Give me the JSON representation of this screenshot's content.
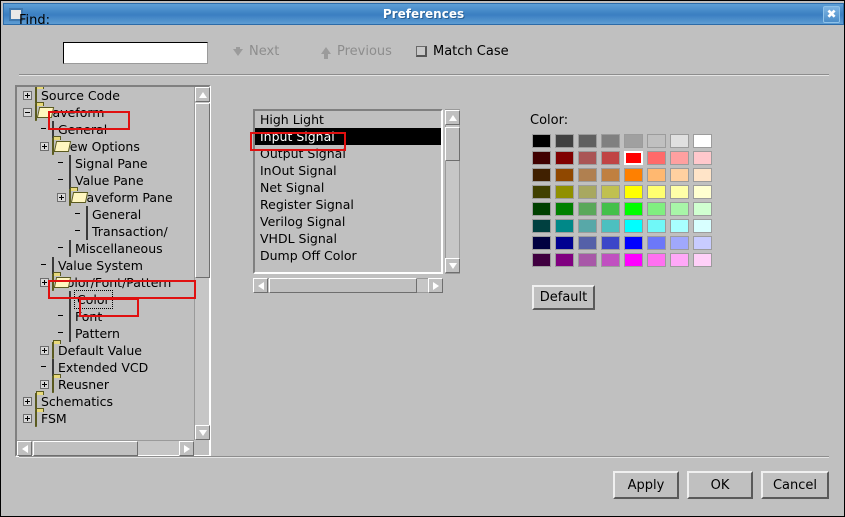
{
  "window": {
    "title": "Preferences",
    "icon": "window-menu-icon",
    "close_label": "✖"
  },
  "toolbar": {
    "find_label": "Find:",
    "find_value": "",
    "find_placeholder": "",
    "next_label": "Next",
    "previous_label": "Previous",
    "match_case_label": "Match Case",
    "match_case_checked": false
  },
  "tree": {
    "items": [
      {
        "label": "Source Code",
        "indent": 0,
        "expander": "plus",
        "icon": "folder-icon"
      },
      {
        "label": "Waveform",
        "indent": 0,
        "expander": "minus",
        "icon": "folder-open-icon",
        "highlight": true
      },
      {
        "label": "General",
        "indent": 1,
        "expander": "none",
        "icon": "document-icon"
      },
      {
        "label": "View Options",
        "indent": 1,
        "expander": "plus",
        "icon": "folder-open-icon"
      },
      {
        "label": "Signal Pane",
        "indent": 2,
        "expander": "none",
        "icon": "document-icon"
      },
      {
        "label": "Value Pane",
        "indent": 2,
        "expander": "none",
        "icon": "document-icon"
      },
      {
        "label": "Waveform Pane",
        "indent": 2,
        "expander": "plus",
        "icon": "folder-open-icon"
      },
      {
        "label": "General",
        "indent": 3,
        "expander": "none",
        "icon": "document-icon"
      },
      {
        "label": "Transaction/",
        "indent": 3,
        "expander": "none",
        "icon": "document-icon"
      },
      {
        "label": "Miscellaneous",
        "indent": 2,
        "expander": "none",
        "icon": "document-icon"
      },
      {
        "label": "Value System",
        "indent": 1,
        "expander": "none",
        "icon": "document-icon"
      },
      {
        "label": "Color/Font/Pattern",
        "indent": 1,
        "expander": "plus",
        "icon": "folder-open-icon",
        "highlight": true
      },
      {
        "label": "Color",
        "indent": 2,
        "expander": "none",
        "icon": "document-icon",
        "selected": true,
        "highlight": true
      },
      {
        "label": "Font",
        "indent": 2,
        "expander": "none",
        "icon": "document-icon"
      },
      {
        "label": "Pattern",
        "indent": 2,
        "expander": "none",
        "icon": "document-icon"
      },
      {
        "label": "Default Value",
        "indent": 1,
        "expander": "plus",
        "icon": "folder-icon"
      },
      {
        "label": "Extended VCD",
        "indent": 1,
        "expander": "none",
        "icon": "document-icon"
      },
      {
        "label": "Reusner",
        "indent": 1,
        "expander": "plus",
        "icon": "folder-icon"
      },
      {
        "label": "Schematics",
        "indent": 0,
        "expander": "plus",
        "icon": "folder-icon"
      },
      {
        "label": "FSM",
        "indent": 0,
        "expander": "plus",
        "icon": "folder-icon"
      }
    ]
  },
  "signal_list": {
    "items": [
      "High Light",
      "Input Signal",
      "Output Signal",
      "InOut Signal",
      "Net Signal",
      "Register Signal",
      "Verilog Signal",
      "VHDL Signal",
      "Dump Off Color"
    ],
    "selected_index": 1
  },
  "color_section": {
    "label": "Color:",
    "default_button": "Default",
    "selected_index": 12,
    "swatches": [
      "#000000",
      "#404040",
      "#606060",
      "#808080",
      "#a0a0a0",
      "#c0c0c0",
      "#e0e0e0",
      "#ffffff",
      "#400000",
      "#800000",
      "#aa5555",
      "#c04444",
      "#ff0000",
      "#ff6a6a",
      "#ffa0a0",
      "#ffc8cc",
      "#402000",
      "#904800",
      "#b08050",
      "#c08040",
      "#ff8000",
      "#ffb870",
      "#ffd0a0",
      "#ffe4c8",
      "#404000",
      "#909000",
      "#a8a860",
      "#c0c050",
      "#ffff00",
      "#ffff70",
      "#ffffa8",
      "#ffffd0",
      "#004000",
      "#008000",
      "#5aa85a",
      "#44c04a",
      "#00ff00",
      "#80ef80",
      "#a8f5a8",
      "#d0ffd0",
      "#004040",
      "#008888",
      "#58a8a8",
      "#4cc0c0",
      "#00ffff",
      "#70f8f8",
      "#a8ffff",
      "#d8ffff",
      "#000040",
      "#000090",
      "#5560a8",
      "#3c46c8",
      "#0000ff",
      "#6c78f8",
      "#a0a8fc",
      "#c8ccff",
      "#400040",
      "#800080",
      "#a858a8",
      "#c050c0",
      "#ff00ff",
      "#ff70f0",
      "#ffa8f8",
      "#ffd0f8"
    ]
  },
  "footer": {
    "apply_label": "Apply",
    "ok_label": "OK",
    "cancel_label": "Cancel"
  },
  "accents": {
    "titlebar_blue": "#3f83c4",
    "highlight_red": "#e01010",
    "face_gray": "#c0c0c0",
    "selection_black": "#000000"
  }
}
